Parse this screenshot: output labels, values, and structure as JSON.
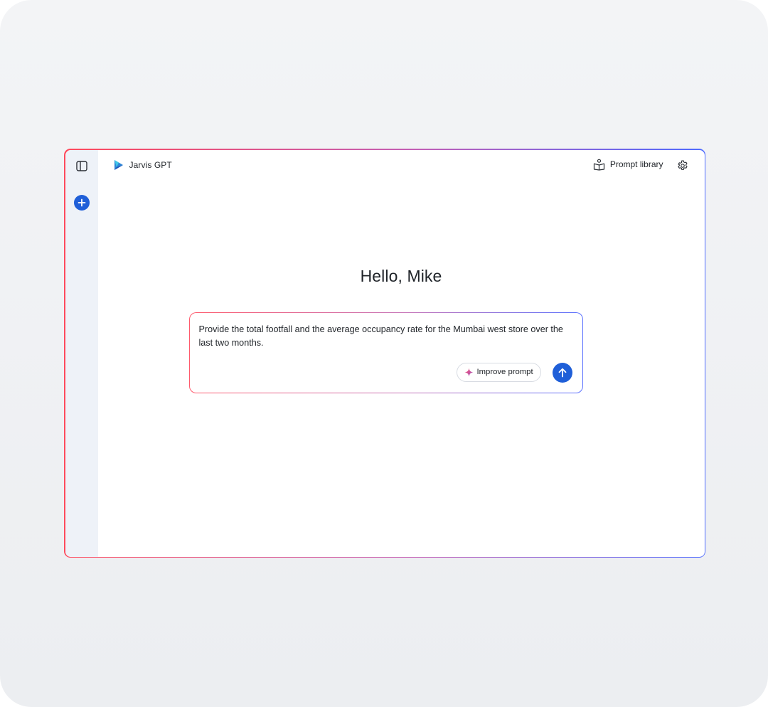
{
  "app": {
    "brand_name": "Jarvis GPT",
    "accent_color": "#1f5fd8"
  },
  "header": {
    "prompt_library_label": "Prompt library",
    "icons": {
      "sidebar_toggle": "sidebar-panel-icon",
      "prompt_library": "book-person-icon",
      "settings": "gear-icon",
      "new_chat": "plus-icon",
      "brand": "jarvis-logo-icon"
    }
  },
  "main": {
    "greeting": "Hello, Mike"
  },
  "composer": {
    "text": "Provide the total footfall and the average occupancy rate for the Mumbai west store over the last two months.",
    "improve_label": "Improve prompt",
    "icons": {
      "improve": "sparkle-icon",
      "send": "arrow-up-icon"
    }
  }
}
